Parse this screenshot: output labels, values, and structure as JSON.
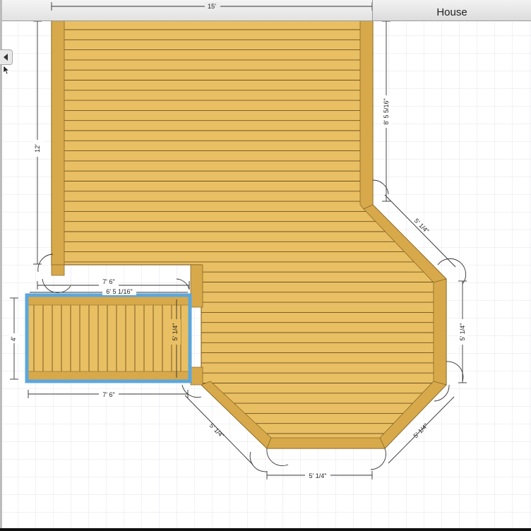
{
  "house": {
    "label": "House"
  },
  "dimensions": {
    "top_width": "15'",
    "left_height": "12'",
    "right_upper": "8' 5 5/16\"",
    "diag_upper_right": "5' 1/4\"",
    "right_vertical": "5' 1/4\"",
    "diag_lower_right": "5' 1/4\"",
    "bottom": "5' 1/4\"",
    "diag_lower_left": "5' 1/4\"",
    "step_top_outer": "7' 6\"",
    "step_top_inner": "6' 5 1/16\"",
    "step_right": "5' 1/4\"",
    "step_left": "4'",
    "step_bottom": "7' 6\""
  },
  "colors": {
    "deck_fill": "#e9bf63",
    "deck_edge": "#cf9f3e",
    "board_line": "#6f5320",
    "selection": "#5ba7dd",
    "grid": "#e4e4ec"
  }
}
